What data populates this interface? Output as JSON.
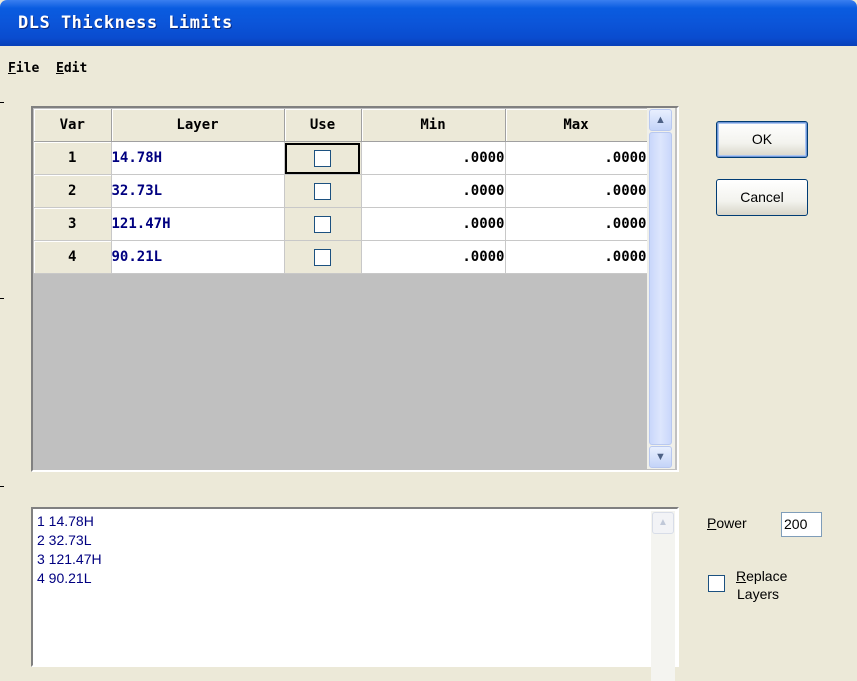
{
  "window": {
    "title": "DLS Thickness Limits"
  },
  "menu": [
    {
      "label": "File",
      "accel": "F",
      "rest": "ile"
    },
    {
      "label": "Edit",
      "accel": "E",
      "rest": "dit"
    }
  ],
  "grid": {
    "headers": [
      "Var",
      "Layer",
      "Use",
      "Min",
      "Max"
    ],
    "rows": [
      {
        "var": "1",
        "layer": "14.78H",
        "use": false,
        "min": ".0000",
        "max": ".0000"
      },
      {
        "var": "2",
        "layer": "32.73L",
        "use": false,
        "min": ".0000",
        "max": ".0000"
      },
      {
        "var": "3",
        "layer": "121.47H",
        "use": false,
        "min": ".0000",
        "max": ".0000"
      },
      {
        "var": "4",
        "layer": "90.21L",
        "use": false,
        "min": ".0000",
        "max": ".0000"
      }
    ]
  },
  "buttons": {
    "ok": "OK",
    "cancel": "Cancel"
  },
  "list": {
    "lines": [
      "1 14.78H",
      "2 32.73L",
      "3 121.47H",
      "4 90.21L"
    ]
  },
  "power": {
    "accel": "P",
    "rest": "ower",
    "value": "200"
  },
  "replace": {
    "accel": "R",
    "rest": "eplace",
    "line2": "Layers",
    "checked": false
  },
  "icons": {
    "scroll_up": "scroll-up-arrow-icon",
    "scroll_down": "scroll-down-arrow-icon"
  },
  "colors": {
    "titlebar": "#0a5ce0",
    "layer_text": "#000080",
    "face": "#ece9d8",
    "grid_bg": "#c0c0c0"
  }
}
